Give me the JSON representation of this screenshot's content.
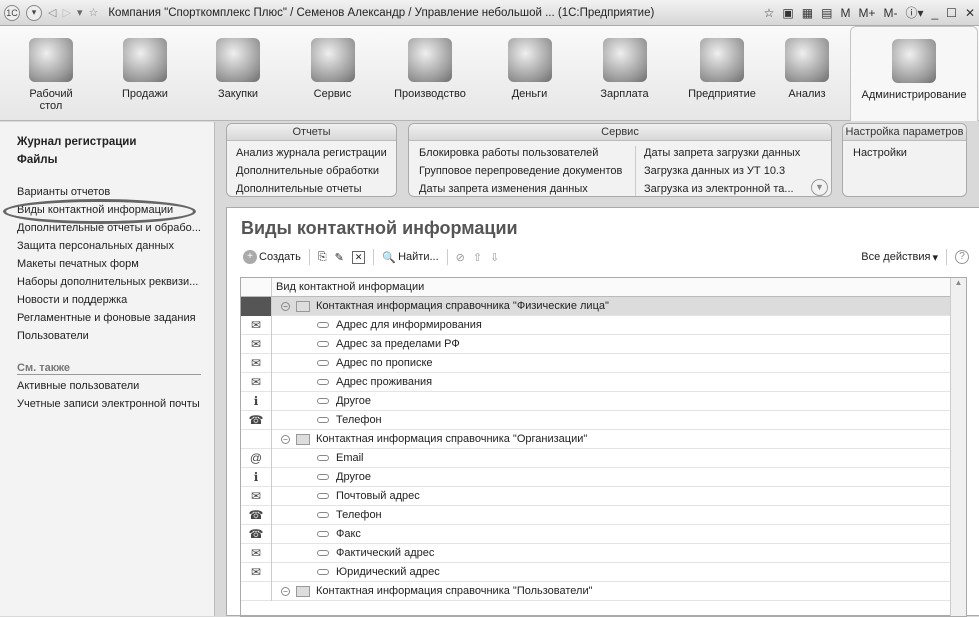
{
  "window": {
    "title": "Компания \"Спорткомплекс Плюс\" / Семенов Александр / Управление небольшой ... (1С:Предприятие)",
    "logo": "1С",
    "mem": [
      "M",
      "M+",
      "M-"
    ]
  },
  "sections": [
    {
      "label": "Рабочий",
      "label2": "стол"
    },
    {
      "label": "Продажи"
    },
    {
      "label": "Закупки"
    },
    {
      "label": "Сервис"
    },
    {
      "label": "Производство"
    },
    {
      "label": "Деньги"
    },
    {
      "label": "Зарплата"
    },
    {
      "label": "Предприятие"
    },
    {
      "label": "Анализ"
    },
    {
      "label": "Администрирование"
    }
  ],
  "left": {
    "bold": [
      "Журнал регистрации",
      "Файлы"
    ],
    "links": [
      "Варианты отчетов",
      "Виды контактной информации",
      "Дополнительные отчеты и обрабо...",
      "Защита персональных данных",
      "Макеты печатных форм",
      "Наборы дополнительных реквизи...",
      "Новости и поддержка",
      "Регламентные и фоновые задания",
      "Пользователи"
    ],
    "see_also": "См. также",
    "see_links": [
      "Активные пользователи",
      "Учетные записи электронной почты"
    ]
  },
  "panels": {
    "reports": {
      "title": "Отчеты",
      "items": [
        "Анализ журнала регистрации",
        "Дополнительные обработки",
        "Дополнительные отчеты"
      ]
    },
    "service": {
      "title": "Сервис",
      "col1": [
        "Блокировка работы пользователей",
        "Групповое перепроведение документов",
        "Даты запрета изменения данных"
      ],
      "col2": [
        "Даты запрета загрузки данных",
        "Загрузка данных из УТ 10.3",
        "Загрузка из электронной та..."
      ]
    },
    "settings": {
      "title": "Настройка параметров",
      "items": [
        "Настройки"
      ]
    }
  },
  "main": {
    "title": "Виды контактной информации",
    "create": "Создать",
    "find": "Найти...",
    "all_actions": "Все действия",
    "help": "?",
    "column": "Вид контактной информации",
    "rows": [
      {
        "type": "group",
        "text": "Контактная информация справочника \"Физические лица\"",
        "sel": true
      },
      {
        "type": "item",
        "icon": "mail",
        "text": "Адрес для информирования"
      },
      {
        "type": "item",
        "icon": "mail",
        "text": "Адрес за пределами РФ"
      },
      {
        "type": "item",
        "icon": "mail",
        "text": "Адрес по прописке"
      },
      {
        "type": "item",
        "icon": "mail",
        "text": "Адрес проживания"
      },
      {
        "type": "item",
        "icon": "info",
        "text": "Другое"
      },
      {
        "type": "item",
        "icon": "phone",
        "text": "Телефон"
      },
      {
        "type": "group",
        "text": "Контактная информация справочника \"Организации\""
      },
      {
        "type": "item",
        "icon": "at",
        "text": "Email"
      },
      {
        "type": "item",
        "icon": "info",
        "text": "Другое"
      },
      {
        "type": "item",
        "icon": "mail",
        "text": "Почтовый адрес"
      },
      {
        "type": "item",
        "icon": "phone",
        "text": "Телефон"
      },
      {
        "type": "item",
        "icon": "phone",
        "text": "Факс"
      },
      {
        "type": "item",
        "icon": "mail",
        "text": "Фактический адрес"
      },
      {
        "type": "item",
        "icon": "mail",
        "text": "Юридический адрес"
      },
      {
        "type": "group",
        "text": "Контактная информация справочника \"Пользователи\""
      }
    ]
  }
}
